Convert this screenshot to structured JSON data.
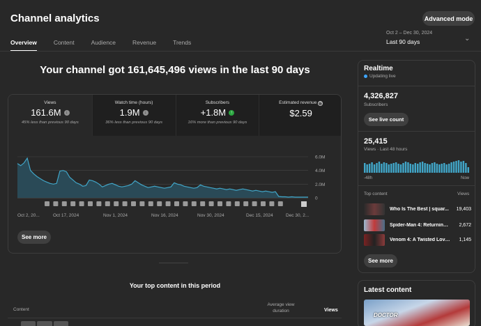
{
  "header": {
    "title": "Channel analytics",
    "advanced_label": "Advanced mode",
    "tabs": [
      {
        "label": "Overview",
        "active": true
      },
      {
        "label": "Content",
        "active": false
      },
      {
        "label": "Audience",
        "active": false
      },
      {
        "label": "Revenue",
        "active": false
      },
      {
        "label": "Trends",
        "active": false
      }
    ],
    "date_range": "Oct 2 – Dec 30, 2024",
    "period": "Last 90 days"
  },
  "overview": {
    "headline": "Your channel got 161,645,496 views in the last 90 days",
    "metrics": [
      {
        "label": "Views",
        "value": "161.6M",
        "note": "45% less than previous 90 days",
        "trend": "down",
        "icon": "down-arrow-icon"
      },
      {
        "label": "Watch time (hours)",
        "value": "1.9M",
        "note": "36% less than previous 90 days",
        "trend": "down",
        "icon": "down-arrow-icon"
      },
      {
        "label": "Subscribers",
        "value": "+1.8M",
        "note": "16% more than previous 90 days",
        "trend": "up",
        "icon": "up-arrow-icon"
      },
      {
        "label": "Estimated revenue",
        "value": "$2.59",
        "note": "",
        "trend": "none",
        "icon": "clock-icon"
      }
    ],
    "see_more_label": "See more",
    "colors": {
      "line": "#41a6c8",
      "fill": "#2a4a57",
      "up": "#2ba640"
    }
  },
  "chart_data": {
    "type": "area",
    "x_tick_labels": [
      "Oct 2, 20...",
      "Oct 17, 2024",
      "Nov 1, 2024",
      "Nov 16, 2024",
      "Nov 30, 2024",
      "Dec 15, 2024",
      "Dec 30, 2..."
    ],
    "y_tick_labels": [
      "6.0M",
      "4.0M",
      "2.0M",
      "0"
    ],
    "ylim": [
      0,
      6000000
    ],
    "series": [
      {
        "values": [
          5000000,
          4700000,
          5100000,
          5800000,
          4000000,
          3500000,
          3100000,
          2800000,
          2500000,
          2300000,
          2100000,
          2000000,
          2100000,
          3900000,
          4000000,
          3800000,
          3000000,
          2600000,
          2200000,
          2000000,
          1700000,
          1800000,
          2600000,
          2500000,
          2300000,
          2000000,
          1600000,
          1800000,
          2000000,
          2100000,
          1900000,
          1700000,
          1600000,
          1700000,
          1800000,
          2000000,
          2500000,
          2200000,
          1900000,
          1700000,
          1500000,
          1600000,
          1700000,
          1600000,
          1500000,
          1400000,
          1500000,
          1600000,
          2200000,
          2000000,
          1900000,
          1700000,
          1600000,
          1500000,
          1400000,
          1500000,
          1900000,
          1700000,
          1600000,
          1500000,
          1400000,
          1300000,
          1400000,
          1300000,
          1200000,
          1300000,
          1200000,
          1100000,
          1200000,
          1300000,
          1200000,
          1100000,
          1000000,
          1100000,
          1000000,
          900000,
          1000000,
          900000,
          800000,
          900000,
          200000,
          150000,
          150000,
          100000,
          150000,
          100000,
          100000,
          100000,
          100000,
          100000
        ]
      }
    ],
    "grid": true
  },
  "top_content": {
    "title": "Your top content in this period",
    "col_content": "Content",
    "col_avg": "Average view duration",
    "col_views": "Views"
  },
  "realtime": {
    "title": "Realtime",
    "live_label": "Updating live",
    "subscribers": "4,326,827",
    "subscribers_label": "Subscribers",
    "live_count_label": "See live count",
    "views": "25,415",
    "views_label": "Views · Last 48 hours",
    "bar_values": [
      14,
      12,
      13,
      15,
      12,
      14,
      16,
      13,
      15,
      14,
      12,
      13,
      14,
      15,
      13,
      12,
      14,
      16,
      15,
      13,
      12,
      14,
      13,
      15,
      16,
      14,
      13,
      12,
      14,
      15,
      13,
      12,
      13,
      14,
      12,
      13,
      15,
      16,
      17,
      18,
      16,
      17,
      14,
      8
    ],
    "bar_start": "-48h",
    "bar_end": "Now",
    "top_content_label": "Top content",
    "top_content_views_label": "Views",
    "items": [
      {
        "title": "Who Is The Best | squar...",
        "views": "19,403",
        "color": "#3a2b2e"
      },
      {
        "title": "Spider-Man 4: Returning ...",
        "views": "2,672",
        "color": "#5a7a90"
      },
      {
        "title": "Venom 4: A Twisted Love...",
        "views": "1,145",
        "color": "#6a3030"
      }
    ],
    "see_more_label": "See more"
  },
  "latest": {
    "title": "Latest content",
    "thumb_text": "DOCTOR"
  }
}
